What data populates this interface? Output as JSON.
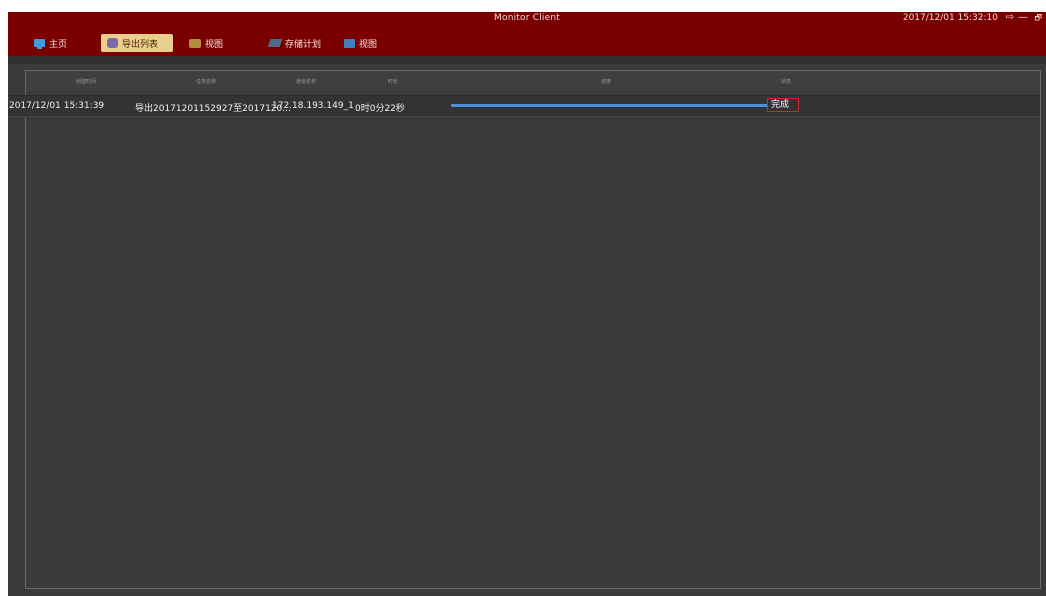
{
  "window": {
    "title": "Monitor Client",
    "clock": "2017/12/01 15:32:10",
    "controls": {
      "logout": "⇨",
      "minimize": "—",
      "restore": "🗗"
    }
  },
  "nav": [
    {
      "label": "主页",
      "icon": "monitor-icon",
      "active": false
    },
    {
      "label": "导出列表",
      "icon": "export-icon",
      "active": true
    },
    {
      "label": "视图",
      "icon": "view-icon",
      "active": false
    },
    {
      "label": "存储计划",
      "icon": "plan-icon",
      "active": false
    },
    {
      "label": "视图",
      "icon": "view-icon",
      "active": false
    }
  ],
  "table": {
    "headers": [
      "创建时间",
      "任务名称",
      "通道名称",
      "时长",
      "进度",
      "状态"
    ],
    "rows": [
      {
        "created": "2017/12/01 15:31:39",
        "task": "导出20171201152927至2017120...",
        "channel": "172.18.193.149_1",
        "duration": "0时0分22秒",
        "progress": 1.0,
        "status": "完成"
      }
    ]
  },
  "colors": {
    "titlebar": "#7a0000",
    "active_tab": "#e8cf8e",
    "progress": "#4e8fdb",
    "status_border": "#c62a2a"
  }
}
